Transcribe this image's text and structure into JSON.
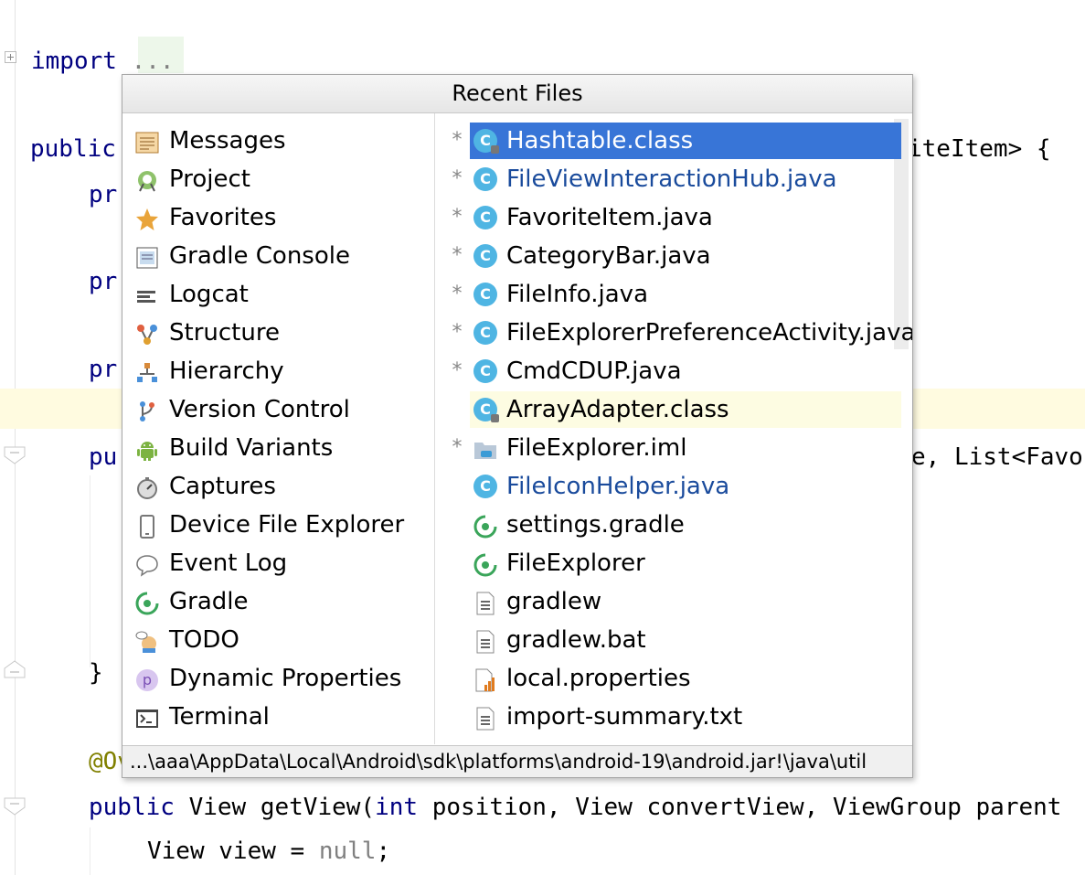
{
  "editor": {
    "lines": {
      "import_kw": "import",
      "import_dots": "...",
      "public_kw": "public",
      "class_tail": "iteItem> {",
      "pr1": "pr",
      "pr2": "pr",
      "pr3": "pr",
      "pu": "pu",
      "ctor_tail": "e, List<Favor",
      "brace": "}",
      "override": "@Ov",
      "getview_public": "public",
      "getview_view": " View getView(",
      "getview_int": "int",
      "getview_rest": " position, View convertView, ViewGroup parent",
      "view_decl": "View view = ",
      "view_null": "null",
      "view_semi": ";"
    }
  },
  "switcher": {
    "title": "Recent Files",
    "tools": [
      {
        "label": "Messages",
        "icon": "messages-icon"
      },
      {
        "label": "Project",
        "icon": "project-icon"
      },
      {
        "label": "Favorites",
        "icon": "favorites-star-icon"
      },
      {
        "label": "Gradle Console",
        "icon": "gradle-console-icon"
      },
      {
        "label": "Logcat",
        "icon": "logcat-icon"
      },
      {
        "label": "Structure",
        "icon": "structure-icon"
      },
      {
        "label": "Hierarchy",
        "icon": "hierarchy-icon"
      },
      {
        "label": "Version Control",
        "icon": "version-control-icon"
      },
      {
        "label": "Build Variants",
        "icon": "android-icon"
      },
      {
        "label": "Captures",
        "icon": "captures-icon"
      },
      {
        "label": "Device File Explorer",
        "icon": "device-icon"
      },
      {
        "label": "Event Log",
        "icon": "event-log-icon"
      },
      {
        "label": "Gradle",
        "icon": "gradle-icon"
      },
      {
        "label": "TODO",
        "icon": "todo-icon"
      },
      {
        "label": "Dynamic Properties",
        "icon": "dynamic-properties-icon"
      },
      {
        "label": "Terminal",
        "icon": "terminal-icon"
      }
    ],
    "files": [
      {
        "label": "Hashtable.class",
        "star": "*",
        "icon": "class-file-icon"
      },
      {
        "label": "FileViewInteractionHub.java",
        "star": "*",
        "icon": "java-class-icon"
      },
      {
        "label": "FavoriteItem.java",
        "star": "*",
        "icon": "java-class-icon"
      },
      {
        "label": "CategoryBar.java",
        "star": "*",
        "icon": "java-class-icon"
      },
      {
        "label": "FileInfo.java",
        "star": "*",
        "icon": "java-class-icon"
      },
      {
        "label": "FileExplorerPreferenceActivity.java",
        "star": "*",
        "icon": "java-class-icon"
      },
      {
        "label": "CmdCDUP.java",
        "star": "*",
        "icon": "java-class-icon"
      },
      {
        "label": "ArrayAdapter.class",
        "star": "",
        "icon": "class-file-icon"
      },
      {
        "label": "FileExplorer.iml",
        "star": "*",
        "icon": "module-folder-icon"
      },
      {
        "label": "FileIconHelper.java",
        "star": "",
        "icon": "java-class-icon"
      },
      {
        "label": "settings.gradle",
        "star": "",
        "icon": "gradle-icon"
      },
      {
        "label": "FileExplorer",
        "star": "",
        "icon": "gradle-icon"
      },
      {
        "label": "gradlew",
        "star": "",
        "icon": "text-file-icon"
      },
      {
        "label": "gradlew.bat",
        "star": "",
        "icon": "text-file-icon"
      },
      {
        "label": "local.properties",
        "star": "",
        "icon": "properties-file-icon"
      },
      {
        "label": "import-summary.txt",
        "star": "",
        "icon": "text-file-icon"
      }
    ],
    "path": "...\\aaa\\AppData\\Local\\Android\\sdk\\platforms\\android-19\\android.jar!\\java\\util"
  }
}
